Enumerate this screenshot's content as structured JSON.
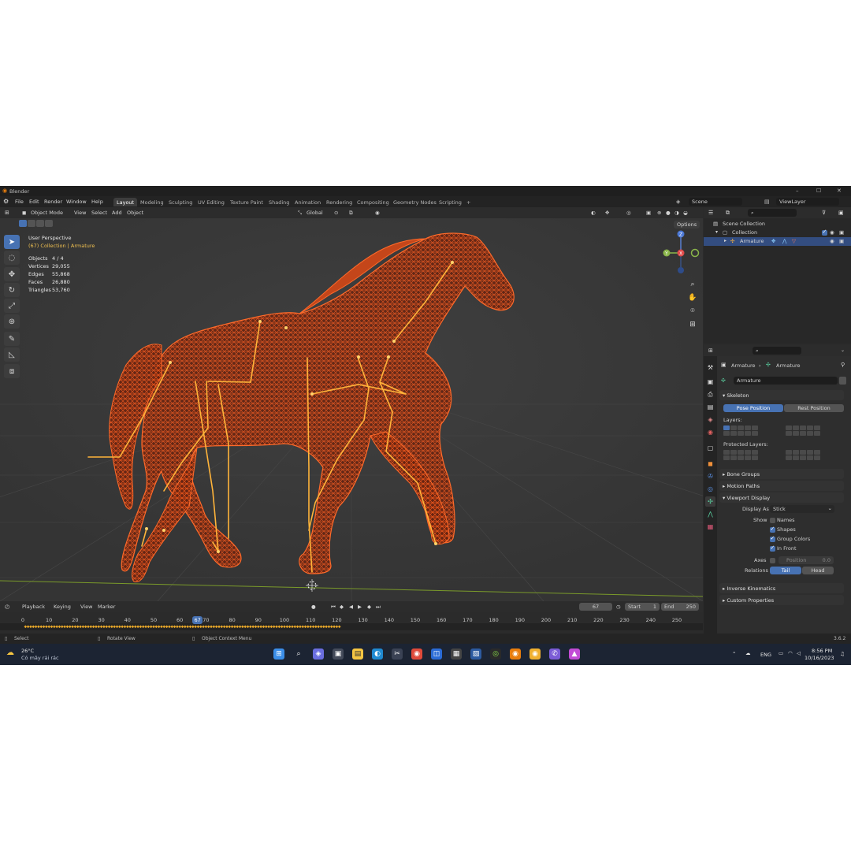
{
  "window": {
    "title": "Blender",
    "minimize": "–",
    "maximize": "☐",
    "close": "✕"
  },
  "menu": {
    "items": [
      "File",
      "Edit",
      "Render",
      "Window",
      "Help"
    ],
    "workspaces": [
      "Layout",
      "Modeling",
      "Sculpting",
      "UV Editing",
      "Texture Paint",
      "Shading",
      "Animation",
      "Rendering",
      "Compositing",
      "Geometry Nodes",
      "Scripting"
    ],
    "add_tab": "+",
    "scene": "Scene",
    "view_layer": "ViewLayer"
  },
  "viewport": {
    "header": {
      "mode": "Object Mode",
      "menus": [
        "View",
        "Select",
        "Add",
        "Object"
      ],
      "transform": "Global",
      "options": "Options"
    },
    "overlay": {
      "perspective": "User Perspective",
      "collection_prefix": "(67) Collection | ",
      "active_object": "Armature"
    },
    "stats": [
      {
        "label": "Objects",
        "value": "4 / 4"
      },
      {
        "label": "Vertices",
        "value": "29,055"
      },
      {
        "label": "Edges",
        "value": "55,868"
      },
      {
        "label": "Faces",
        "value": "26,880"
      },
      {
        "label": "Triangles",
        "value": "53,760"
      }
    ],
    "gizmo": {
      "z": "Z",
      "y": "Y",
      "x": "X"
    }
  },
  "outliner": {
    "search_placeholder": "",
    "scene_collection": "Scene Collection",
    "collection": "Collection",
    "armature": "Armature"
  },
  "properties": {
    "breadcrumb_a": "Armature",
    "breadcrumb_b": "Armature",
    "data_name": "Armature",
    "skeleton": "Skeleton",
    "pose_position": "Pose Position",
    "rest_position": "Rest Position",
    "layers": "Layers:",
    "protected_layers": "Protected Layers:",
    "bone_groups": "Bone Groups",
    "motion_paths": "Motion Paths",
    "viewport_display": "Viewport Display",
    "display_as_label": "Display As",
    "display_as_value": "Stick",
    "show_label": "Show",
    "names": "Names",
    "shapes": "Shapes",
    "group_colors": "Group Colors",
    "in_front": "In Front",
    "axes_label": "Axes",
    "position_label": "Position",
    "position_value": "0.0",
    "relations_label": "Relations",
    "tail": "Tail",
    "head": "Head",
    "inverse_kinematics": "Inverse Kinematics",
    "custom_properties": "Custom Properties"
  },
  "timeline": {
    "menus": [
      "Playback",
      "Keying",
      "View",
      "Marker"
    ],
    "current_frame": "67",
    "start_label": "Start",
    "start": "1",
    "end_label": "End",
    "end": "250",
    "ticks": [
      "0",
      "10",
      "20",
      "30",
      "40",
      "50",
      "60",
      "70",
      "80",
      "90",
      "100",
      "110",
      "120",
      "130",
      "140",
      "150",
      "160",
      "170",
      "180",
      "190",
      "200",
      "210",
      "220",
      "230",
      "240",
      "250"
    ],
    "playhead": "67"
  },
  "statusbar": {
    "select": "Select",
    "rotate": "Rotate View",
    "context": "Object Context Menu",
    "version": "3.6.2"
  },
  "taskbar": {
    "temperature": "26°C",
    "weather": "Có mây rải rác",
    "lang": "ENG",
    "time": "8:56 PM",
    "date": "10/16/2023"
  },
  "colors": {
    "accent": "#4772b3",
    "mesh": "#e8521c",
    "bone": "#ffb43a",
    "selected_row": "#334d80"
  }
}
